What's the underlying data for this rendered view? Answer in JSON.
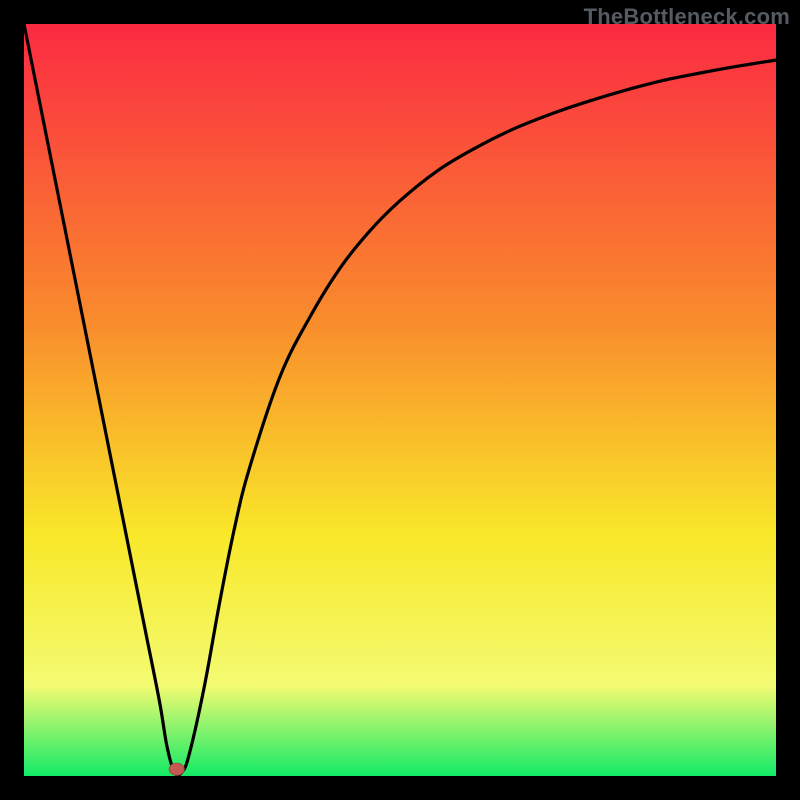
{
  "watermark": "TheBottleneck.com",
  "colors": {
    "gradient_top": "#fb2a42",
    "gradient_mid1": "#f98d2c",
    "gradient_mid2": "#f9e829",
    "gradient_mid3": "#f3fb72",
    "gradient_bottom": "#12ea66",
    "curve": "#000000",
    "marker_fill": "#c25a53",
    "marker_stroke": "#a74741",
    "background": "#000000"
  },
  "chart_data": {
    "type": "line",
    "title": "",
    "xlabel": "",
    "ylabel": "",
    "xlim": [
      0,
      100
    ],
    "ylim": [
      0,
      100
    ],
    "curve": {
      "x": [
        0,
        4,
        8,
        12,
        14,
        16,
        18,
        19,
        20,
        21,
        22,
        24,
        26,
        28,
        30,
        34,
        38,
        42,
        46,
        50,
        55,
        60,
        65,
        70,
        75,
        80,
        85,
        90,
        95,
        100
      ],
      "y": [
        100,
        80,
        60,
        40,
        30,
        20,
        10,
        4,
        0.5,
        0.5,
        3,
        12,
        23,
        33,
        41,
        53,
        61,
        67.5,
        72.5,
        76.5,
        80.5,
        83.5,
        86,
        88,
        89.7,
        91.2,
        92.5,
        93.5,
        94.4,
        95.2
      ]
    },
    "marker": {
      "x": 20.3,
      "y": 0.9
    },
    "grid": false,
    "legend": false
  }
}
